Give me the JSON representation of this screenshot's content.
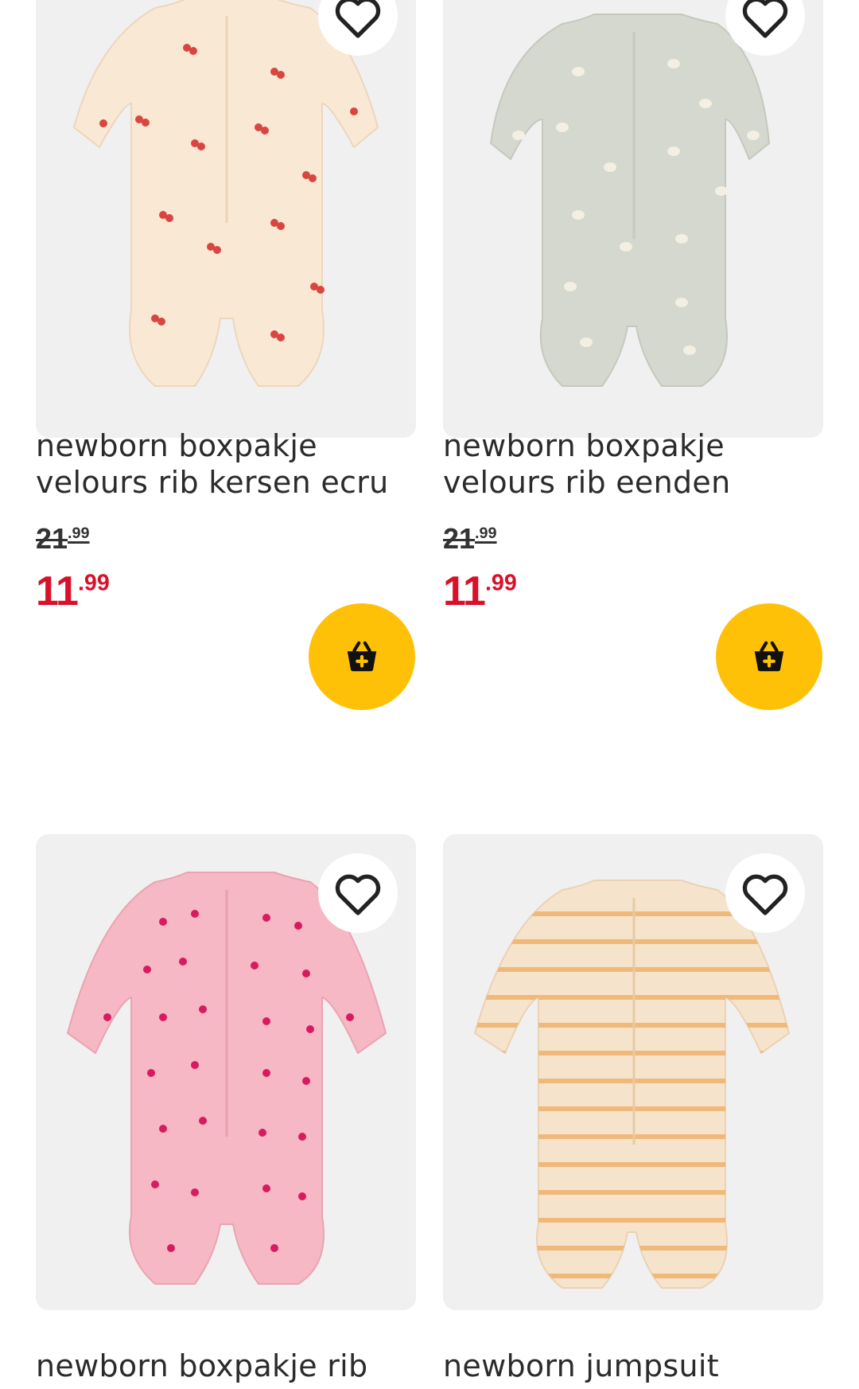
{
  "products": [
    {
      "title_line1": "newborn boxpakje",
      "title_line2": "velours rib kersen ecru",
      "old_price_main": "21",
      "old_price_cents": ".99",
      "new_price_main": "11",
      "new_price_cents": ".99",
      "garment_color": "#f9e9d4",
      "pattern": "cherries"
    },
    {
      "title_line1": "newborn boxpakje",
      "title_line2": "velours rib eenden",
      "old_price_main": "21",
      "old_price_cents": ".99",
      "new_price_main": "11",
      "new_price_cents": ".99",
      "garment_color": "#d4d8ce",
      "pattern": "ducks"
    },
    {
      "title_line1": "newborn boxpakje rib",
      "garment_color": "#f6b8c4",
      "pattern": "flowers"
    },
    {
      "title_line1": "newborn jumpsuit",
      "garment_color": "#f6e3cc",
      "pattern": "stripes"
    }
  ],
  "icons": {
    "favorite": "heart-outline-icon",
    "cart": "basket-plus-icon"
  },
  "colors": {
    "price_red": "#d9102a",
    "cart_button": "#ffc107",
    "image_bg": "#f0f0f0"
  }
}
